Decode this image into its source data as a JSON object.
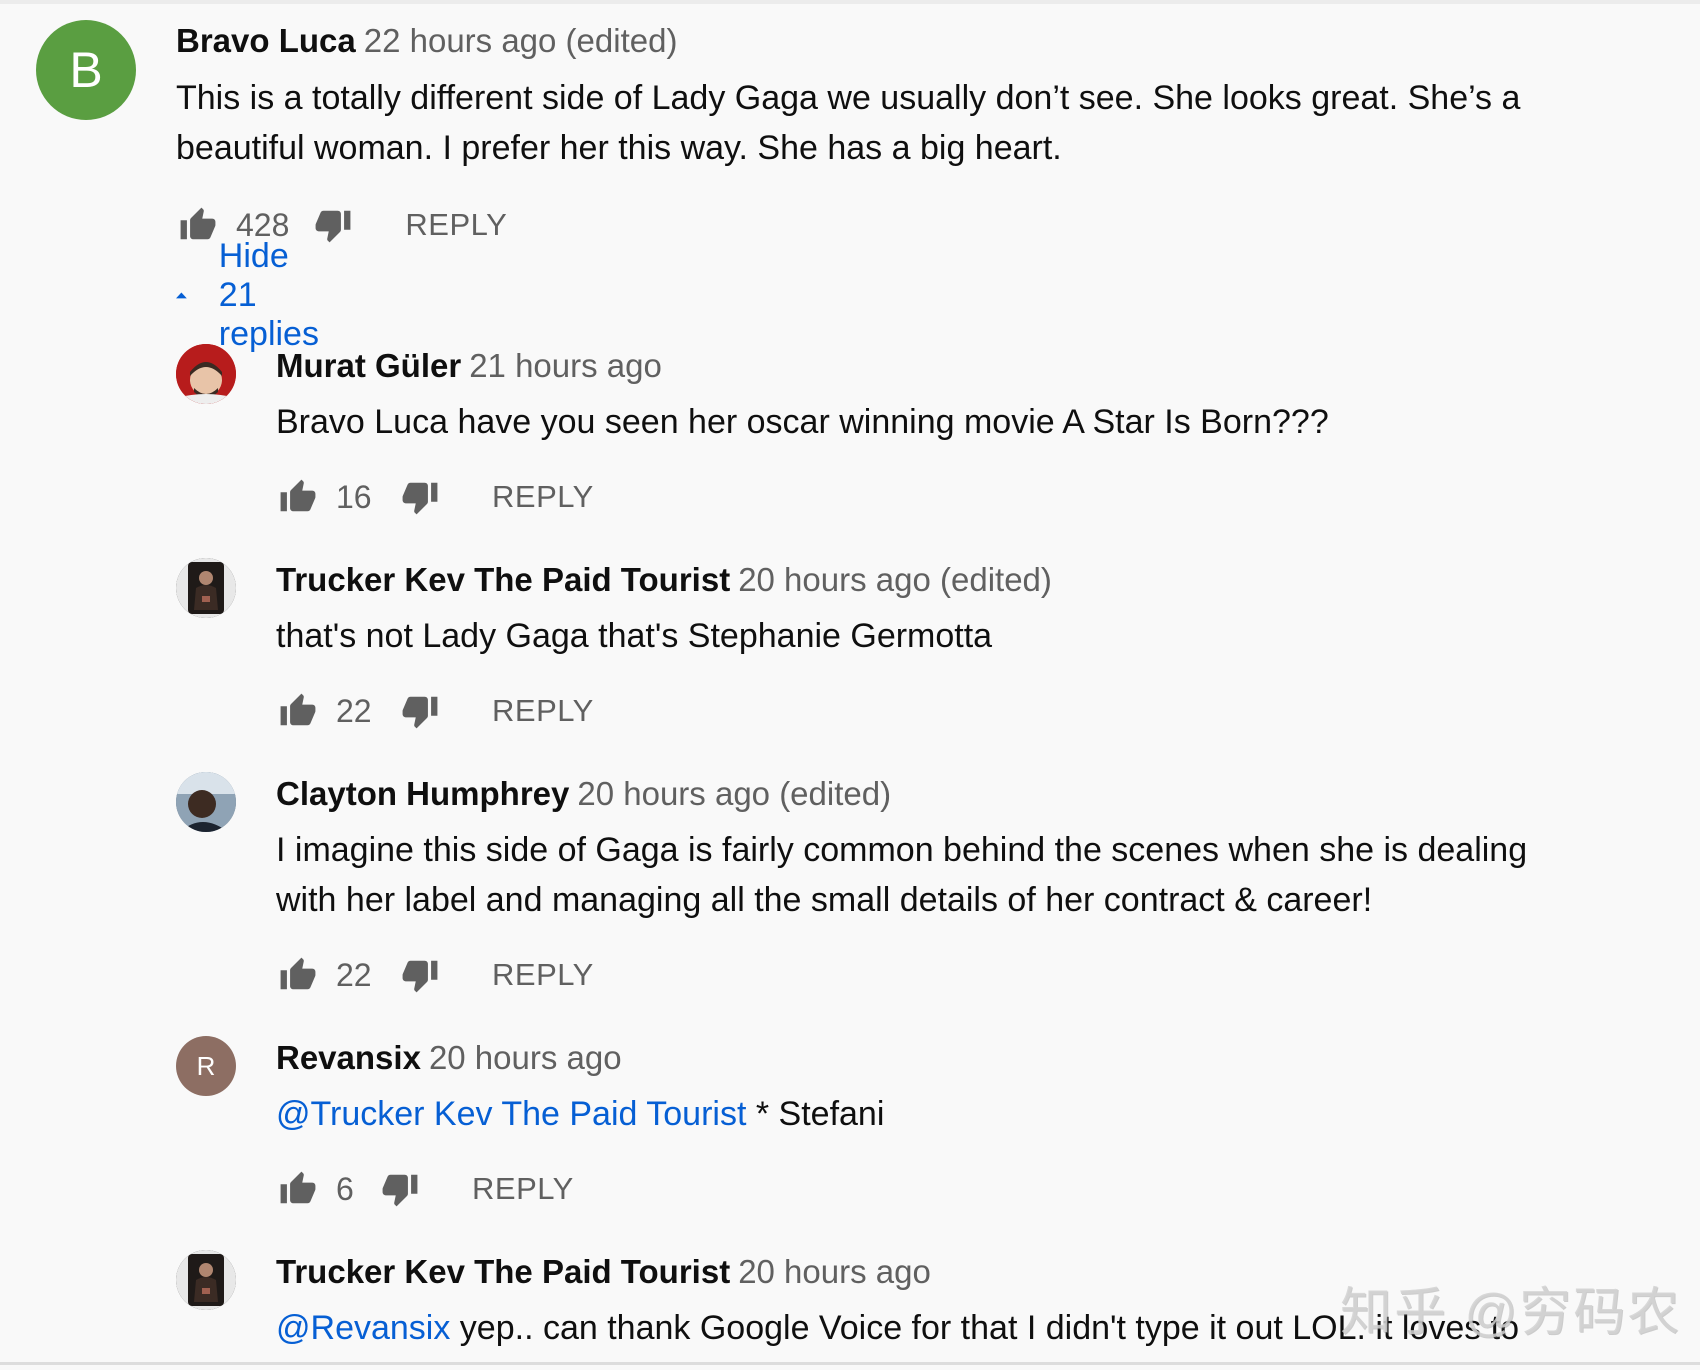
{
  "comments": [
    {
      "author": "Bravo Luca",
      "meta": "22 hours ago (edited)",
      "avatar_letter": "B",
      "avatar_color": "#5a9e41",
      "text_lines": [
        "This is a totally different side of Lady Gaga we usually don’t see.  She looks great. She’s a",
        "beautiful woman. I prefer her this way. She has a big heart."
      ],
      "likes": "428",
      "reply_label": "REPLY",
      "toggle_label": "Hide 21 replies"
    }
  ],
  "replies": [
    {
      "author": "Murat Güler",
      "meta": "21 hours ago",
      "text_lines": [
        "Bravo Luca have you seen her oscar winning movie A Star Is Born???"
      ],
      "likes": "16",
      "reply_label": "REPLY"
    },
    {
      "author": "Trucker Kev The Paid Tourist",
      "meta": "20 hours ago (edited)",
      "text_lines": [
        "that's not Lady Gaga that's Stephanie Germotta"
      ],
      "likes": "22",
      "reply_label": "REPLY"
    },
    {
      "author": "Clayton Humphrey",
      "meta": "20 hours ago (edited)",
      "text_lines": [
        "I imagine this side of Gaga is fairly common behind the scenes when she is dealing",
        "with her label and managing all the small details of her contract & career!"
      ],
      "likes": "22",
      "reply_label": "REPLY"
    },
    {
      "author": "Revansix",
      "meta": "20 hours ago",
      "avatar_letter": "R",
      "avatar_color": "#8d6e63",
      "mention": "@Trucker Kev The Paid Tourist",
      "text_after_mention": " * Stefani",
      "likes": "6",
      "reply_label": "REPLY"
    },
    {
      "author": "Trucker Kev The Paid Tourist",
      "meta": "20 hours ago",
      "mention": "@Revansix",
      "text_after_mention": " yep.. can thank Google Voice for that I didn't type it out LOL. it loves to"
    }
  ],
  "watermark": "知乎 @穷码农",
  "colors": {
    "link": "#065fd4",
    "secondary_text": "#606060",
    "background": "#f9f9f9"
  },
  "icons": [
    "like-icon",
    "dislike-icon",
    "chevron-up-icon"
  ]
}
